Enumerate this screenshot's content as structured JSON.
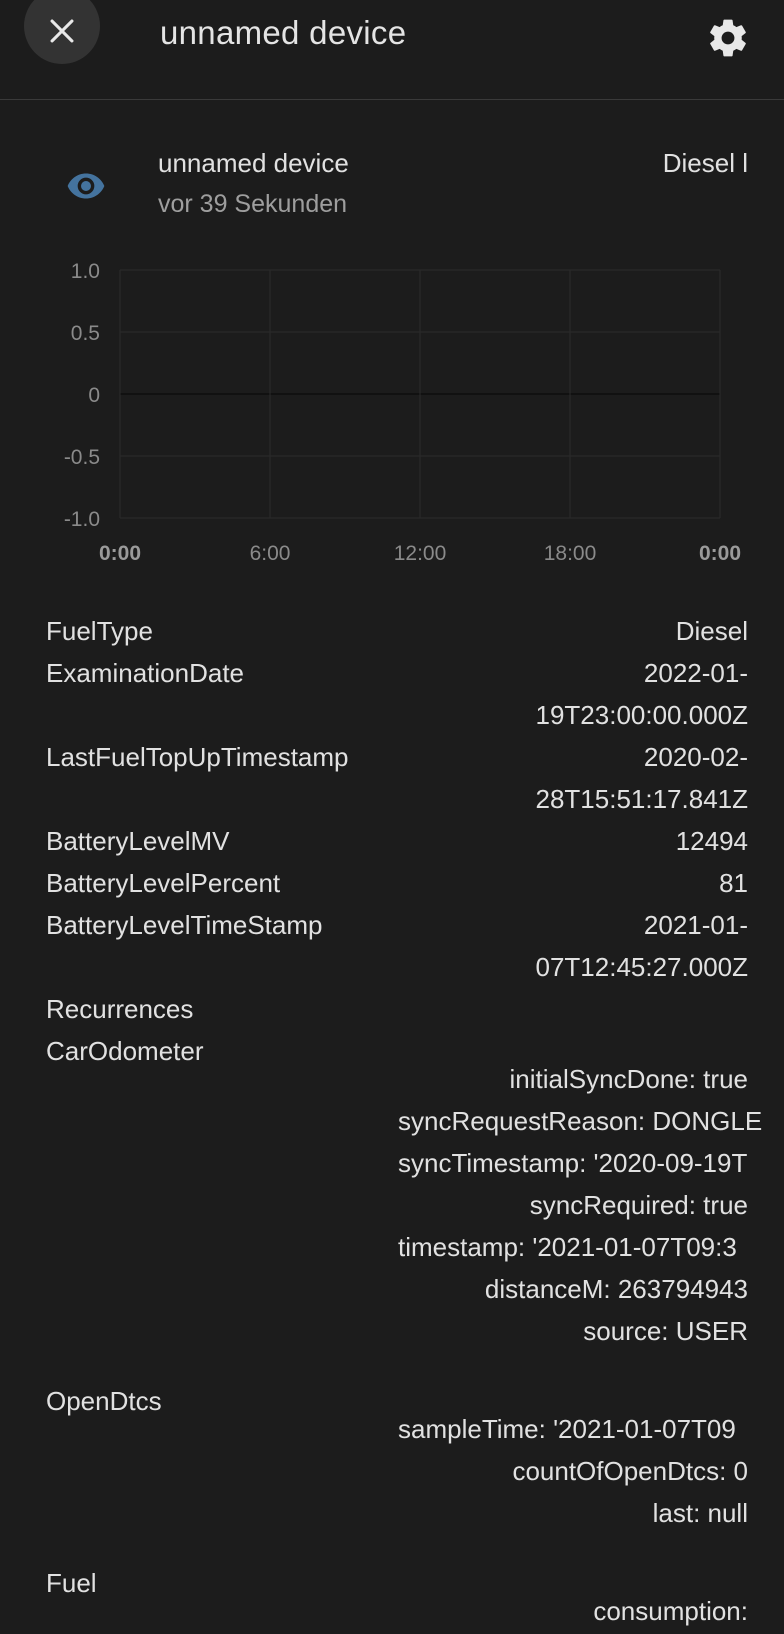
{
  "header": {
    "title": "unnamed device"
  },
  "entity": {
    "name": "unnamed device",
    "last_changed": "vor 39 Sekunden",
    "state": "Diesel l"
  },
  "chart_data": {
    "type": "line",
    "y_ticks": [
      "1.0",
      "0.5",
      "0",
      "-0.5",
      "-1.0"
    ],
    "x_ticks": [
      "0:00",
      "6:00",
      "12:00",
      "18:00",
      "0:00"
    ],
    "ylim": [
      -1.0,
      1.0
    ],
    "series": [],
    "grid": true
  },
  "attributes": {
    "fuel_type": {
      "name": "FuelType",
      "value": "Diesel"
    },
    "examination_date": {
      "name": "ExaminationDate",
      "value_line1": "2022-01-",
      "value_line2": "19T23:00:00.000Z"
    },
    "last_fuel_topup": {
      "name": "LastFuelTopUpTimestamp",
      "value_line1": "2020-02-",
      "value_line2": "28T15:51:17.841Z"
    },
    "battery_mv": {
      "name": "BatteryLevelMV",
      "value": "12494"
    },
    "battery_percent": {
      "name": "BatteryLevelPercent",
      "value": "81"
    },
    "battery_timestamp": {
      "name": "BatteryLevelTimeStamp",
      "value_line1": "2021-01-",
      "value_line2": "07T12:45:27.000Z"
    },
    "recurrences": {
      "name": "Recurrences"
    },
    "car_odometer": {
      "name": "CarOdometer",
      "lines": [
        "initialSyncDone: true",
        "syncRequestReason: DONGLE",
        "syncTimestamp: '2020-09-19T",
        "syncRequired: true",
        "timestamp: '2021-01-07T09:3",
        "distanceM: 263794943",
        "source: USER"
      ]
    },
    "open_dtcs": {
      "name": "OpenDtcs",
      "lines": [
        "sampleTime: '2021-01-07T09",
        "countOfOpenDtcs: 0",
        "last: null"
      ]
    },
    "fuel": {
      "name": "Fuel",
      "lines": [
        "consumption:"
      ]
    }
  }
}
